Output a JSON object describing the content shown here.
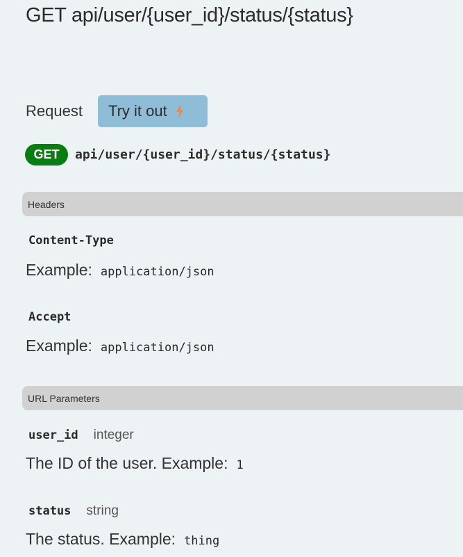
{
  "title": "GET api/user/{user_id}/status/{status}",
  "request": {
    "label": "Request",
    "try_button_label": "Try it out",
    "try_button_icon": "lightning-bolt-icon",
    "accent_color": "#f0893a"
  },
  "endpoint": {
    "method": "GET",
    "method_color": "#0a7d12",
    "path": "api/user/{user_id}/status/{status}"
  },
  "headers": {
    "section_label": "Headers",
    "items": [
      {
        "name": "Content-Type",
        "example_label": "Example:",
        "example_value": "application/json"
      },
      {
        "name": "Accept",
        "example_label": "Example:",
        "example_value": "application/json"
      }
    ]
  },
  "url_parameters": {
    "section_label": "URL Parameters",
    "items": [
      {
        "name": "user_id",
        "type": "integer",
        "description": "The ID of the user. Example:",
        "example_value": "1"
      },
      {
        "name": "status",
        "type": "string",
        "description": "The status. Example:",
        "example_value": "thing"
      }
    ]
  }
}
